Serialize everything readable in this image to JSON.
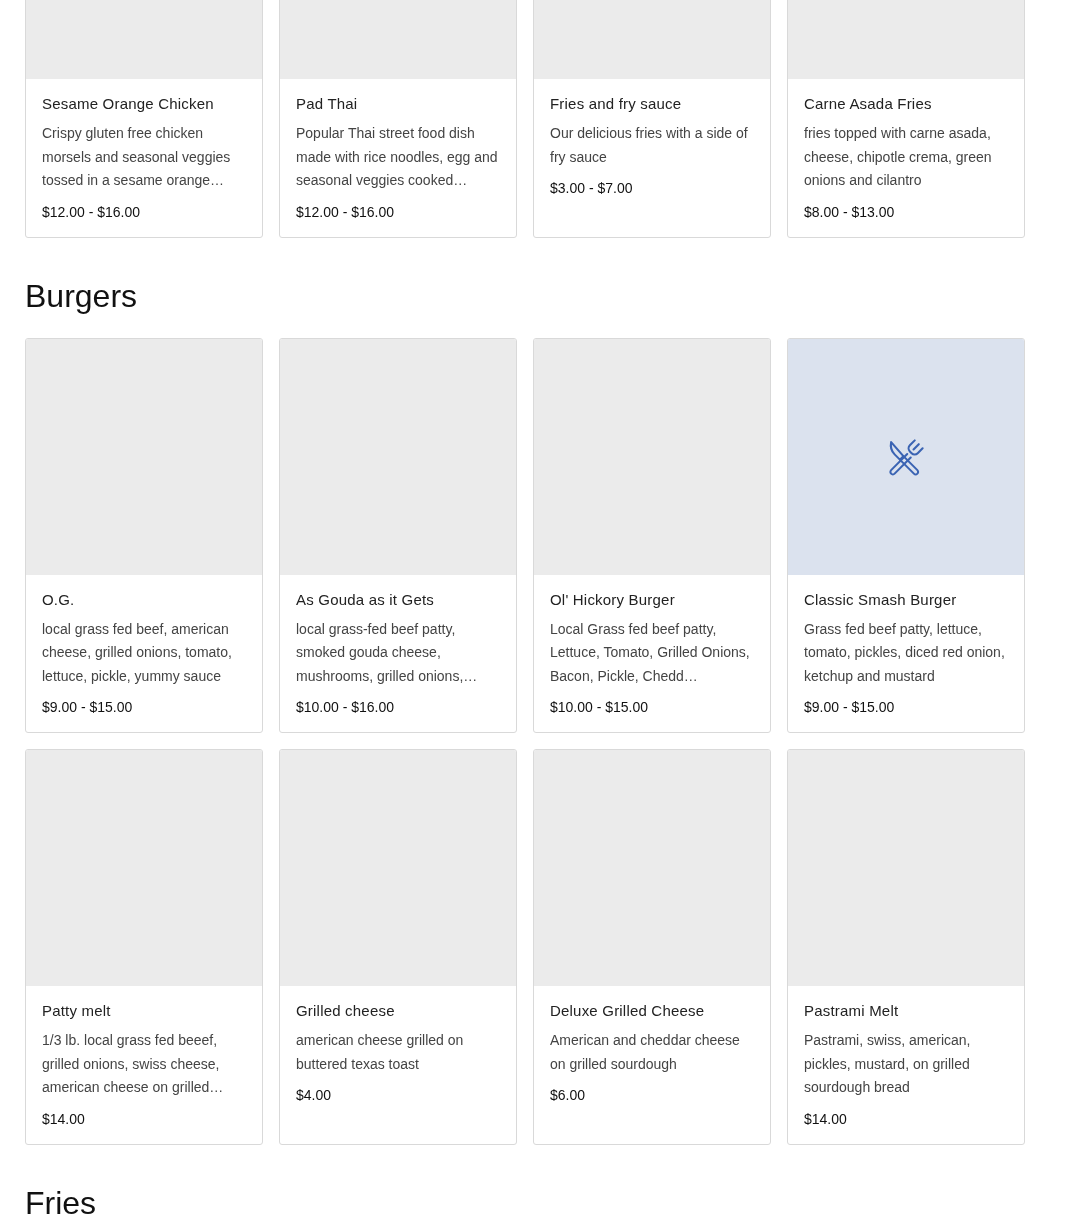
{
  "sections": [
    {
      "items": [
        {
          "name": "Sesame Orange Chicken",
          "description": "Crispy gluten free chicken morsels and seasonal veggies tossed in a sesame orange…",
          "price": "$12.00 - $16.00",
          "image": {
            "kind": "placeholder"
          }
        },
        {
          "name": "Pad Thai",
          "description": "Popular Thai street food dish made with rice noodles, egg and seasonal veggies cooked…",
          "price": "$12.00 - $16.00",
          "image": {
            "kind": "placeholder"
          }
        },
        {
          "name": "Fries and fry sauce",
          "description": "Our delicious fries with a side of fry sauce",
          "price": "$3.00 - $7.00",
          "image": {
            "kind": "placeholder"
          }
        },
        {
          "name": "Carne Asada Fries",
          "description": "fries topped with carne asada, cheese, chipotle crema, green onions and cilantro",
          "price": "$8.00 - $13.00",
          "image": {
            "kind": "placeholder"
          }
        }
      ]
    },
    {
      "title": "Burgers",
      "items": [
        {
          "name": "O.G.",
          "description": "local grass fed beef, american cheese, grilled onions, tomato, lettuce, pickle, yummy sauce",
          "price": "$9.00 - $15.00",
          "image": {
            "kind": "placeholder"
          }
        },
        {
          "name": "As Gouda as it Gets",
          "description": "local grass-fed beef patty, smoked gouda cheese, mushrooms, grilled onions,…",
          "price": "$10.00 - $16.00",
          "image": {
            "kind": "placeholder"
          }
        },
        {
          "name": "Ol' Hickory Burger",
          "description": "Local Grass fed beef patty, Lettuce, Tomato, Grilled Onions, Bacon, Pickle, Chedd…",
          "price": "$10.00 - $15.00",
          "image": {
            "kind": "placeholder"
          }
        },
        {
          "name": "Classic Smash Burger",
          "description": "Grass fed beef patty, lettuce, tomato, pickles, diced red onion, ketchup and mustard",
          "price": "$9.00 - $15.00",
          "image": {
            "kind": "utensils"
          }
        },
        {
          "name": "Patty melt",
          "description": "1/3 lb. local grass fed beeef, grilled onions, swiss cheese, american cheese on grilled…",
          "price": "$14.00",
          "image": {
            "kind": "placeholder"
          }
        },
        {
          "name": "Grilled cheese",
          "description": "american cheese grilled on buttered texas toast",
          "price": "$4.00",
          "image": {
            "kind": "placeholder"
          }
        },
        {
          "name": "Deluxe Grilled Cheese",
          "description": "American and cheddar cheese on grilled sourdough",
          "price": "$6.00",
          "image": {
            "kind": "placeholder"
          }
        },
        {
          "name": "Pastrami Melt",
          "description": "Pastrami, swiss, american, pickles, mustard, on grilled sourdough bread",
          "price": "$14.00",
          "image": {
            "kind": "placeholder"
          }
        }
      ]
    },
    {
      "title": "Fries"
    }
  ]
}
